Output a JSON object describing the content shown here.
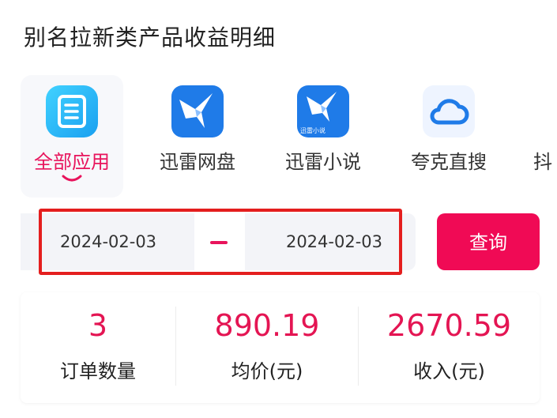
{
  "page": {
    "title": "别名拉新类产品收益明细"
  },
  "apps": [
    {
      "label": "全部应用",
      "icon": "all-apps-icon",
      "active": true
    },
    {
      "label": "迅雷网盘",
      "icon": "xunlei-bird-icon",
      "active": false
    },
    {
      "label": "迅雷小说",
      "icon": "xunlei-novel-icon",
      "icon_caption": "迅雷小说",
      "active": false
    },
    {
      "label": "夸克直搜",
      "icon": "cloud-icon",
      "active": false
    },
    {
      "label": "抖",
      "icon": "",
      "active": false
    }
  ],
  "date_range": {
    "start": "2024-02-03",
    "end": "2024-02-03",
    "separator": "–"
  },
  "query_label": "查询",
  "stats": [
    {
      "value": "3",
      "label": "订单数量"
    },
    {
      "value": "890.19",
      "label": "均价(元)"
    },
    {
      "value": "2670.59",
      "label": "收入(元)"
    }
  ],
  "colors": {
    "accent": "#e8145c",
    "highlight": "#e41e1e",
    "xunlei_blue": "#1f7be8"
  }
}
